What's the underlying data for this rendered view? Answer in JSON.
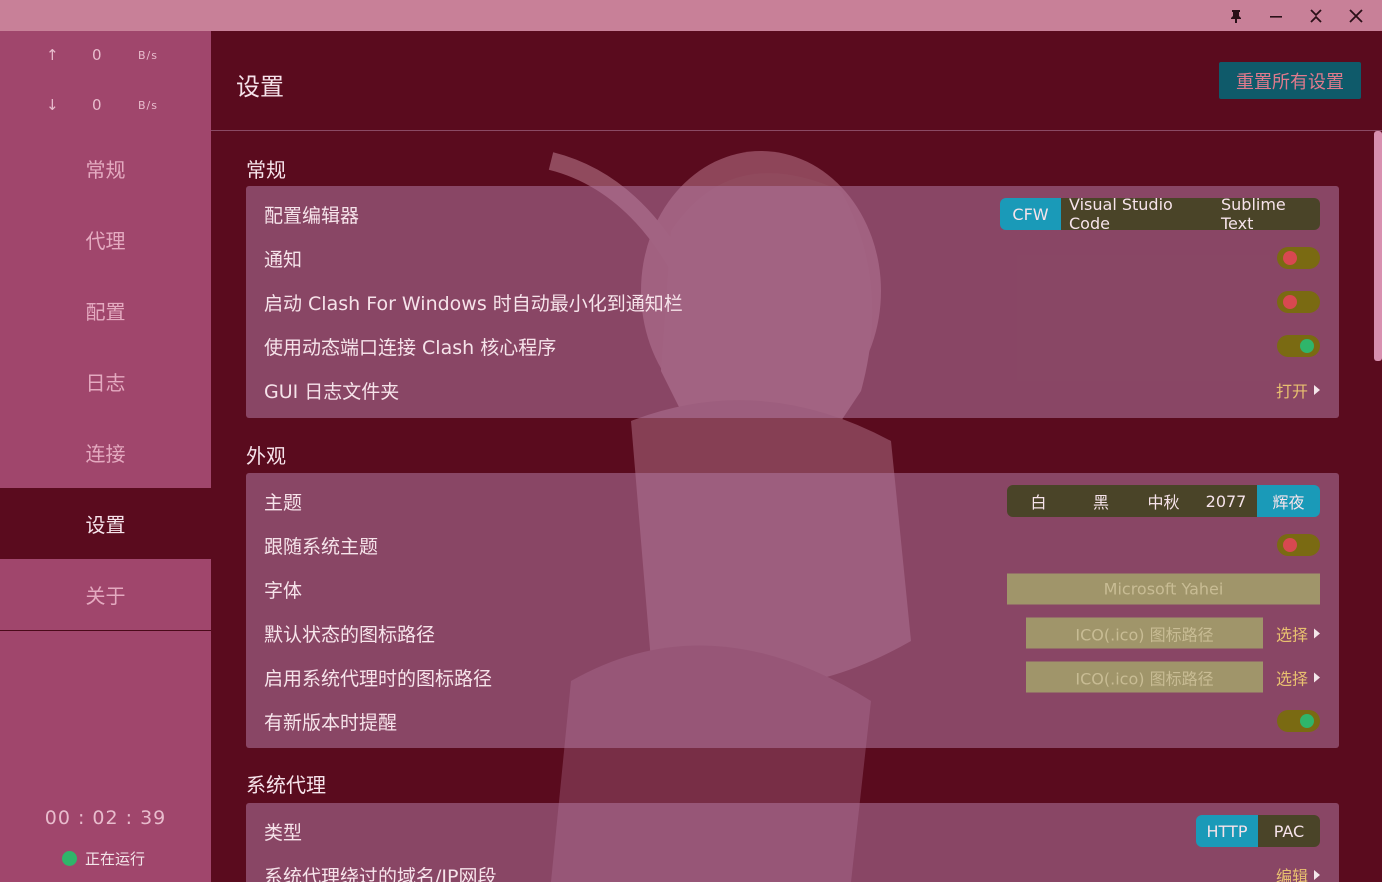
{
  "window": {
    "pin_icon": "pin-icon",
    "minimize_icon": "minimize-icon",
    "collapse_icon": "collapse-icon",
    "close_icon": "close-icon"
  },
  "sidebar": {
    "upload": {
      "arrow": "↑",
      "value": "0",
      "unit": "B/s"
    },
    "download": {
      "arrow": "↓",
      "value": "0",
      "unit": "B/s"
    },
    "items": [
      {
        "label": "常规"
      },
      {
        "label": "代理"
      },
      {
        "label": "配置"
      },
      {
        "label": "日志"
      },
      {
        "label": "连接"
      },
      {
        "label": "设置"
      },
      {
        "label": "关于"
      }
    ],
    "active_item": "设置",
    "timer": "00 : 02 : 39",
    "status": "正在运行"
  },
  "header": {
    "title": "设置",
    "reset_label": "重置所有设置"
  },
  "sections": {
    "general": {
      "title": "常规",
      "editor_label": "配置编辑器",
      "editor_options": [
        "CFW",
        "Visual Studio Code",
        "Sublime Text"
      ],
      "editor_selected": "CFW",
      "notify_label": "通知",
      "notify_on": false,
      "autominimize_label": "启动 Clash For Windows 时自动最小化到通知栏",
      "autominimize_on": false,
      "dynport_label": "使用动态端口连接 Clash 核心程序",
      "dynport_on": true,
      "logdir_label": "GUI 日志文件夹",
      "logdir_action": "打开"
    },
    "appearance": {
      "title": "外观",
      "theme_label": "主题",
      "theme_options": [
        "白",
        "黑",
        "中秋",
        "2077",
        "辉夜"
      ],
      "theme_selected": "辉夜",
      "follow_label": "跟随系统主题",
      "follow_on": false,
      "font_label": "字体",
      "font_placeholder": "Microsoft Yahei",
      "icon_default_label": "默认状态的图标路径",
      "icon_default_placeholder": "ICO(.ico) 图标路径",
      "icon_default_action": "选择",
      "icon_proxy_label": "启用系统代理时的图标路径",
      "icon_proxy_placeholder": "ICO(.ico) 图标路径",
      "icon_proxy_action": "选择",
      "update_label": "有新版本时提醒",
      "update_on": true
    },
    "sysproxy": {
      "title": "系统代理",
      "type_label": "类型",
      "type_options": [
        "HTTP",
        "PAC"
      ],
      "type_selected": "HTTP",
      "bypass_label": "系统代理绕过的域名/IP网段",
      "bypass_action": "编辑"
    }
  }
}
